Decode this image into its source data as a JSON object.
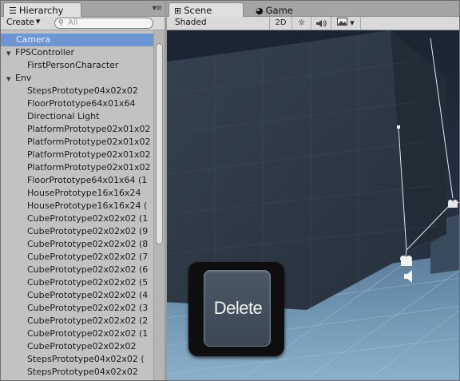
{
  "hierarchy": {
    "tab_label": "Hierarchy",
    "menu_glyph": "▾≡",
    "create_label": "Create",
    "search_placeholder": "All",
    "rows": [
      {
        "label": "Camera",
        "level": "root",
        "selected": true
      },
      {
        "label": "FPSController",
        "level": "root-fold",
        "selected": false
      },
      {
        "label": "FirstPersonCharacter",
        "level": "child",
        "selected": false
      },
      {
        "label": "Env",
        "level": "root-fold",
        "selected": false
      },
      {
        "label": "StepsPrototype04x02x02",
        "level": "child",
        "selected": false
      },
      {
        "label": "FloorPrototype64x01x64",
        "level": "child",
        "selected": false
      },
      {
        "label": "Directional Light",
        "level": "child",
        "selected": false
      },
      {
        "label": "PlatformPrototype02x01x02",
        "level": "child",
        "selected": false
      },
      {
        "label": "PlatformPrototype02x01x02",
        "level": "child",
        "selected": false
      },
      {
        "label": "PlatformPrototype02x01x02",
        "level": "child",
        "selected": false
      },
      {
        "label": "PlatformPrototype02x01x02",
        "level": "child",
        "selected": false
      },
      {
        "label": "FloorPrototype64x01x64 (1",
        "level": "child",
        "selected": false
      },
      {
        "label": "HousePrototype16x16x24",
        "level": "child",
        "selected": false
      },
      {
        "label": "HousePrototype16x16x24 (",
        "level": "child",
        "selected": false
      },
      {
        "label": "CubePrototype02x02x02 (1",
        "level": "child",
        "selected": false
      },
      {
        "label": "CubePrototype02x02x02 (9",
        "level": "child",
        "selected": false
      },
      {
        "label": "CubePrototype02x02x02 (8",
        "level": "child",
        "selected": false
      },
      {
        "label": "CubePrototype02x02x02 (7",
        "level": "child",
        "selected": false
      },
      {
        "label": "CubePrototype02x02x02 (6",
        "level": "child",
        "selected": false
      },
      {
        "label": "CubePrototype02x02x02 (5",
        "level": "child",
        "selected": false
      },
      {
        "label": "CubePrototype02x02x02 (4",
        "level": "child",
        "selected": false
      },
      {
        "label": "CubePrototype02x02x02 (3",
        "level": "child",
        "selected": false
      },
      {
        "label": "CubePrototype02x02x02 (2",
        "level": "child",
        "selected": false
      },
      {
        "label": "CubePrototype02x02x02 (1",
        "level": "child",
        "selected": false
      },
      {
        "label": "CubePrototype02x02x02",
        "level": "child",
        "selected": false
      },
      {
        "label": "StepsPrototype04x02x02 (",
        "level": "child",
        "selected": false
      },
      {
        "label": "StepsPrototype04x02x02",
        "level": "child",
        "selected": false
      }
    ]
  },
  "scene": {
    "tabs": [
      {
        "label": "Scene",
        "icon": "scene-grid-icon",
        "active": true
      },
      {
        "label": "Game",
        "icon": "pacman-icon",
        "active": false
      }
    ],
    "shading_mode": "Shaded",
    "toggle_2d_label": "2D",
    "toolbar_icons": [
      "sun-icon",
      "speaker-icon",
      "image-effects-icon"
    ]
  },
  "overlay": {
    "key_label": "Delete"
  },
  "colors": {
    "selection": "#6d95d3",
    "panel_bg": "#c2c2c2",
    "viewport_sky": "#1d2735",
    "wall": "#2d3a4b",
    "gizmo_line": "#dfe8ff"
  }
}
